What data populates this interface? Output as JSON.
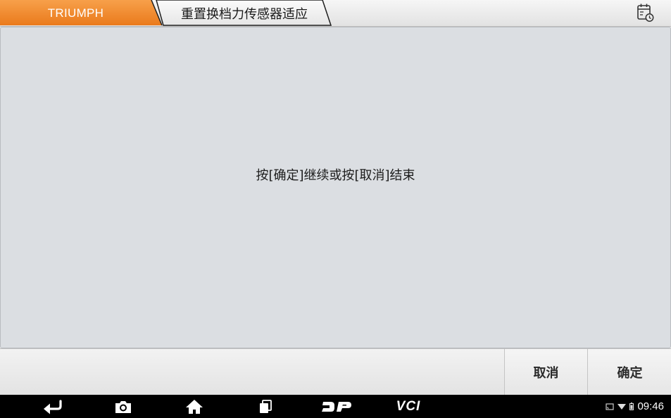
{
  "header": {
    "brand": "TRIUMPH",
    "page_title": "重置换档力传感器适应",
    "brand_color": "#f08a2c"
  },
  "main": {
    "message": "按[确定]继续或按[取消]结束"
  },
  "actions": {
    "cancel_label": "取消",
    "ok_label": "确定"
  },
  "navbar": {
    "items": [
      "back-icon",
      "screenshot-icon",
      "home-icon",
      "recent-apps-icon",
      "dp-icon",
      "vci-icon"
    ],
    "vci_label": "VCI",
    "time": "09:46"
  }
}
